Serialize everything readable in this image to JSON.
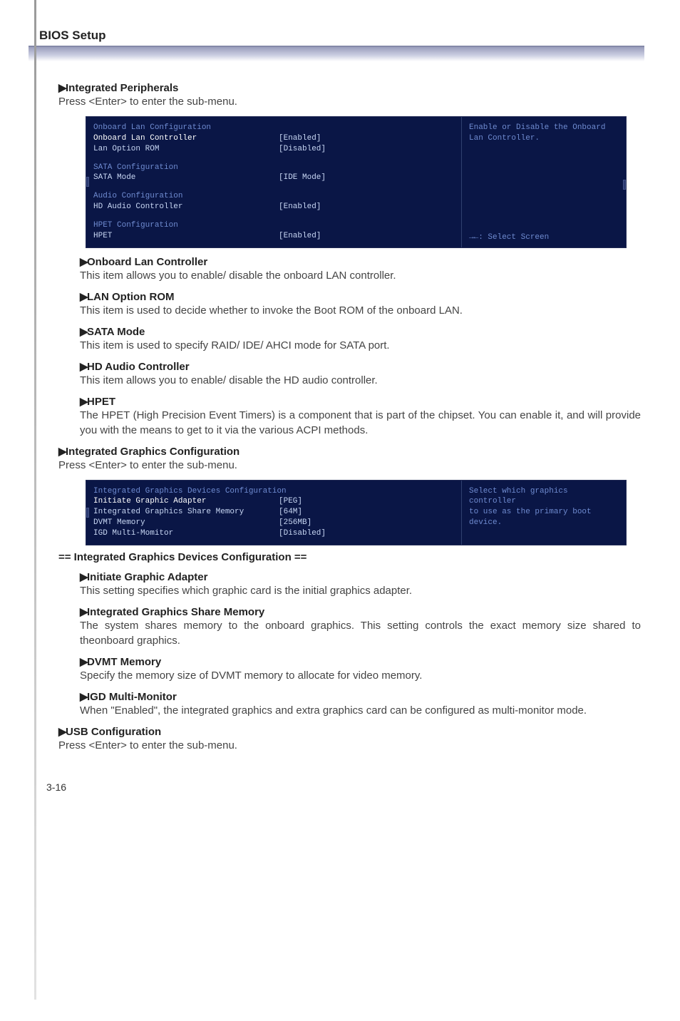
{
  "header": {
    "title": "BIOS Setup"
  },
  "sec_ip": {
    "heading": "Integrated Peripherals",
    "desc": "Press <Enter> to enter the sub-menu."
  },
  "bios1": {
    "cat1": "Onboard Lan Configuration",
    "r1a": "Onboard Lan Controller",
    "r1av": "[Enabled]",
    "r1b": "Lan Option ROM",
    "r1bv": "[Disabled]",
    "cat2": "SATA Configuration",
    "r2a": "SATA Mode",
    "r2av": "[IDE Mode]",
    "cat3": "Audio Configuration",
    "r3a": "HD Audio Controller",
    "r3av": "[Enabled]",
    "cat4": "HPET Configuration",
    "r4a": "HPET",
    "r4av": "[Enabled]",
    "help1": "Enable or Disable the Onboard",
    "help2": "Lan Controller.",
    "nav": "→←: Select Screen"
  },
  "olc": {
    "heading": "Onboard Lan Controller",
    "desc": "This item allows you to enable/ disable the onboard LAN controller."
  },
  "lor": {
    "heading": "LAN Option ROM",
    "desc": "This item is used to decide whether to invoke the Boot ROM of the onboard LAN."
  },
  "sata": {
    "heading": "SATA Mode",
    "desc": "This item is used to specify RAID/ IDE/ AHCI mode for SATA port."
  },
  "hdac": {
    "heading": "HD Audio Controller",
    "desc": "This item allows you to enable/ disable the HD audio controller."
  },
  "hpet": {
    "heading": "HPET",
    "desc": "The HPET (High Precision Event Timers) is a component that is part of the chipset. You can enable it, and will provide you with the means to get to it via the various ACPI methods."
  },
  "sec_igc": {
    "heading": "Integrated Graphics Configuration",
    "desc": "Press <Enter> to enter the sub-menu."
  },
  "bios2": {
    "cat1": "Integrated Graphics Devices Configuration",
    "r1": "Initiate Graphic Adapter",
    "r1v": "[PEG]",
    "r2": "Integrated Graphics Share Memory",
    "r2v": "[64M]",
    "r3": "DVMT Memory",
    "r3v": "[256MB]",
    "r4": "IGD Multi-Momitor",
    "r4v": "[Disabled]",
    "help1": "Select which graphics controller",
    "help2": "to use as the primary boot",
    "help3": "device."
  },
  "igdc_title": "== Integrated Graphics Devices Configuration ==",
  "iga": {
    "heading": "Initiate Graphic Adapter",
    "desc": "This setting specifies which graphic card is the initial graphics adapter."
  },
  "igsm": {
    "heading": "Integrated Graphics Share Memory",
    "desc": "The system shares memory to the onboard graphics. This setting controls the exact memory size shared to theonboard graphics."
  },
  "dvmt": {
    "heading": "DVMT Memory",
    "desc": "Specify the memory size of DVMT memory to allocate for video memory."
  },
  "igdmm": {
    "heading": "IGD Multi-Monitor",
    "desc": "When \"Enabled\", the integrated graphics and extra graphics card can be configured as multi-monitor mode."
  },
  "sec_usb": {
    "heading": "USB Configuration",
    "desc": "Press <Enter> to enter the sub-menu."
  },
  "footer": {
    "page": "3-16"
  }
}
